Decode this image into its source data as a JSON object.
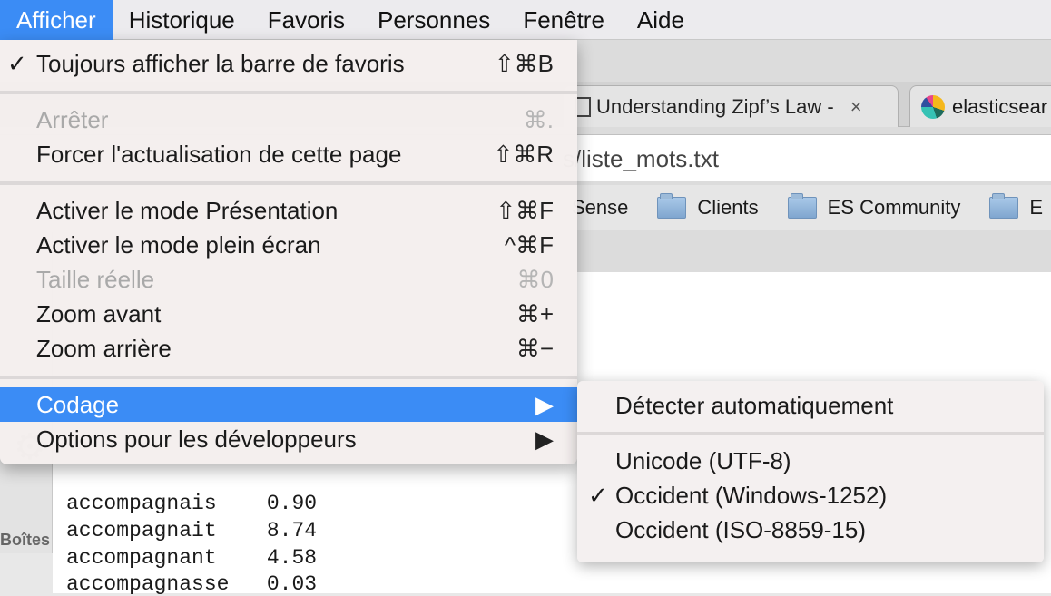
{
  "menubar": {
    "items": [
      "Afficher",
      "Historique",
      "Favoris",
      "Personnes",
      "Fenêtre",
      "Aide"
    ],
    "active": "Afficher"
  },
  "browser": {
    "tabs": [
      {
        "title": "Understanding Zipf’s Law -",
        "close": "×"
      },
      {
        "title": "elasticsear"
      }
    ],
    "address": "s/liste_mots.txt",
    "bookmarks": [
      "Sense",
      "Clients",
      "ES Community",
      "E"
    ]
  },
  "sidebar": {
    "label": "Boîtes"
  },
  "content": {
    "lines": [
      {
        "word": "accompagnais",
        "value": "0.90"
      },
      {
        "word": "accompagnait",
        "value": "8.74"
      },
      {
        "word": "accompagnant",
        "value": "4.58"
      },
      {
        "word": "accompagnasse",
        "value": "0.03"
      }
    ]
  },
  "menu": {
    "items": [
      {
        "label": "Toujours afficher la barre de favoris",
        "shortcut": "⇧⌘B",
        "checked": "✓"
      },
      {
        "label": "Arrêter",
        "shortcut": "⌘.",
        "disabled": true
      },
      {
        "label": "Forcer l'actualisation de cette page",
        "shortcut": "⇧⌘R"
      },
      {
        "label": "Activer le mode Présentation",
        "shortcut": "⇧⌘F"
      },
      {
        "label": "Activer le mode plein écran",
        "shortcut": "^⌘F"
      },
      {
        "label": "Taille réelle",
        "shortcut": "⌘0",
        "disabled": true
      },
      {
        "label": "Zoom avant",
        "shortcut": "⌘+"
      },
      {
        "label": "Zoom arrière",
        "shortcut": "⌘−"
      },
      {
        "label": "Codage",
        "shortcut": "▶",
        "highlighted": true
      },
      {
        "label": "Options pour les développeurs",
        "shortcut": "▶"
      }
    ]
  },
  "submenu": {
    "items": [
      {
        "label": "Détecter automatiquement"
      },
      {
        "label": "Unicode (UTF-8)"
      },
      {
        "label": "Occident (Windows-1252)",
        "checked": "✓"
      },
      {
        "label": "Occident (ISO-8859-15)"
      }
    ]
  },
  "colors": {
    "highlight": "#3b8cf5"
  }
}
